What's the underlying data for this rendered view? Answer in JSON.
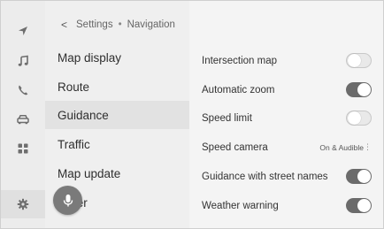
{
  "breadcrumb": {
    "root": "Settings",
    "current": "Navigation"
  },
  "menu": {
    "items": [
      {
        "label": "Map display"
      },
      {
        "label": "Route"
      },
      {
        "label": "Guidance"
      },
      {
        "label": "Traffic"
      },
      {
        "label": "Map update"
      },
      {
        "label": "Other"
      }
    ],
    "selected_index": 2
  },
  "rail": {
    "icons": [
      "navigation-arrow-icon",
      "music-note-icon",
      "phone-icon",
      "car-icon",
      "apps-grid-icon",
      "settings-gear-icon"
    ],
    "active": "settings-gear-icon"
  },
  "settings": [
    {
      "label": "Intersection map",
      "type": "toggle",
      "state": "off"
    },
    {
      "label": "Automatic zoom",
      "type": "toggle",
      "state": "on"
    },
    {
      "label": "Speed limit",
      "type": "toggle",
      "state": "off"
    },
    {
      "label": "Speed camera",
      "type": "value",
      "value": "On & Audible"
    },
    {
      "label": "Guidance with street names",
      "type": "toggle",
      "state": "on"
    },
    {
      "label": "Weather warning",
      "type": "toggle",
      "state": "on"
    }
  ],
  "voice_button": {
    "icon": "microphone-icon"
  },
  "colors": {
    "toggle_on": "#6b6b6b",
    "toggle_off": "#e9e9e9",
    "selected_row": "#e2e2e2"
  }
}
